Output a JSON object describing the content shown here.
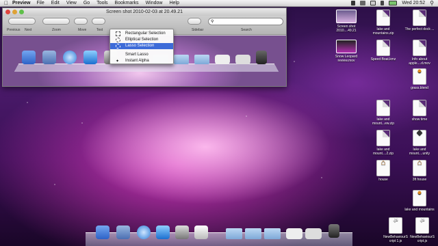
{
  "menubar": {
    "apple": "",
    "app": "Preview",
    "items": [
      "File",
      "Edit",
      "View",
      "Go",
      "Tools",
      "Bookmarks",
      "Window",
      "Help"
    ],
    "clock": "Wed 20:52"
  },
  "window": {
    "title": "Screen shot 2010-02-03 at 20.49.21",
    "toolbar": {
      "previous": "Previous",
      "next": "Next",
      "zoom": "Zoom",
      "move": "Move",
      "text": "Text",
      "sidebar": "Sidebar",
      "search_label": "Search"
    }
  },
  "select_menu": {
    "items": [
      "Rectangular Selection",
      "Elliptical Selection",
      "Lasso Selection",
      "Smart Lasso",
      "Instant Alpha"
    ],
    "selected_index": 2
  },
  "desktop": {
    "icons": [
      {
        "label": "Screen shot 2010....49.21",
        "kind": "thumb"
      },
      {
        "label": "Snow Leopard review.mov",
        "kind": "movie"
      },
      {
        "label": "lake and mountains.zip",
        "kind": "zip"
      },
      {
        "label": "Info about apple....d.mov",
        "kind": "movie"
      },
      {
        "label": "The perfect dock ...",
        "kind": "doc"
      },
      {
        "label": "Speed Boat.kmz",
        "kind": "doc"
      },
      {
        "label": "grass.blend",
        "kind": "blend"
      },
      {
        "label": "lake and mount...ew.zip",
        "kind": "zip"
      },
      {
        "label": "show time",
        "kind": "doc"
      },
      {
        "label": "lake and mount....2.zip",
        "kind": "zip"
      },
      {
        "label": "lake and mount....unity",
        "kind": "unity"
      },
      {
        "label": "house",
        "kind": "house"
      },
      {
        "label": "3ft house",
        "kind": "house"
      },
      {
        "label": "lake and mountains",
        "kind": "folder"
      },
      {
        "label": "NewBehaviourS cript 1.js",
        "kind": "js"
      },
      {
        "label": "NewBehaviourS cript.js",
        "kind": "js"
      }
    ]
  },
  "colors": {
    "accent": "#3d6bd8",
    "wallpaper_glow": "#e040c8"
  }
}
